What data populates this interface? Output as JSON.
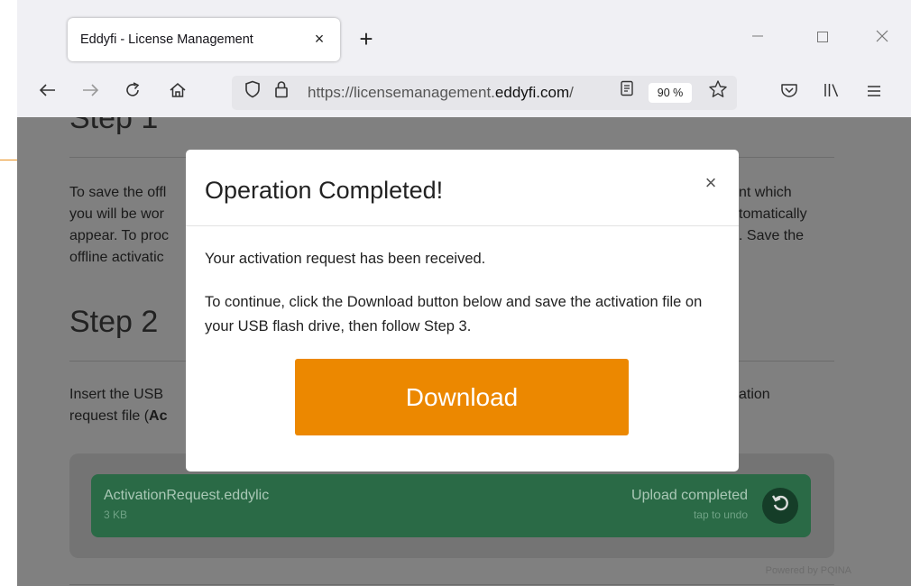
{
  "browser": {
    "tab_title": "Eddyfi - License Management",
    "tab_close": "×",
    "new_tab": "+",
    "url_prefix": "https://licensemanagement.",
    "url_domain": "eddyfi.com",
    "url_suffix": "/",
    "zoom": "90 %"
  },
  "page": {
    "step1_heading": "Step 1",
    "step1_lines": [
      "To save the offl",
      "you will be wor",
      "appear. To proc",
      "offline activatic"
    ],
    "step1_right_lines": [
      "nt which",
      "tomatically",
      ". Save the"
    ],
    "step2_heading": "Step 2",
    "step2_line1_left": "Insert the USB",
    "step2_line1_right": "ation",
    "step2_line2_left": "request file (",
    "step2_line2_bold": "Ac"
  },
  "upload": {
    "file_name": "ActivationRequest.eddylic",
    "file_size": "3 KB",
    "status": "Upload completed",
    "status_sub": "tap to undo",
    "powered_by": "Powered by PQINA"
  },
  "modal": {
    "title": "Operation Completed!",
    "close": "×",
    "text1": "Your activation request has been received.",
    "text2": "To continue, click the Download button below and save the activation file on your USB flash drive, then follow Step 3.",
    "download_label": "Download"
  },
  "colors": {
    "download_button": "#ec8800",
    "upload_success": "#2a6a46",
    "overlay": "#808080"
  }
}
